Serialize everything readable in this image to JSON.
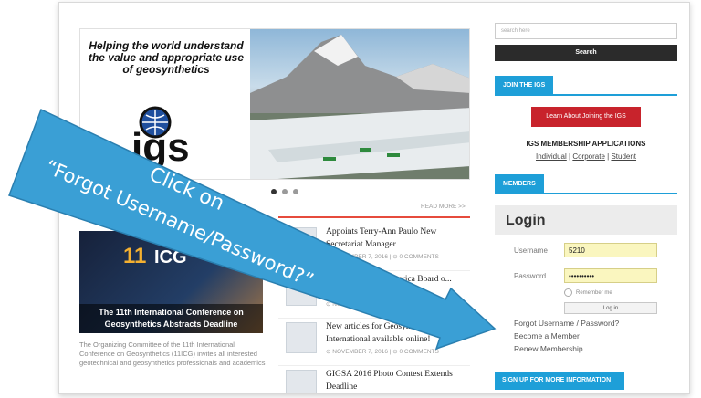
{
  "hero": {
    "tagline": "Helping the world understand the value and appropriate use of geosynthetics",
    "logo_text": "igs"
  },
  "carousel": {
    "dots": 3,
    "active": 1
  },
  "event": {
    "number": "11",
    "abbr": "ICG",
    "caption": "The 11th International Conference on Geosynthetics Abstracts Deadline",
    "excerpt": "The Organizing Committee of the 11th International Conference on Geosynthetics (11ICG) invites all interested geotechnical and geosynthetics professionals and academics"
  },
  "news": {
    "read_more": "READ MORE >>",
    "items": [
      {
        "title": "Appoints Terry-Ann Paulo New Secretariat Manager",
        "meta": "⊙ NOVEMBER 7, 2016  |  ⊙ 0 COMMENTS"
      },
      {
        "title": "Call for ... South America Board o...",
        "meta": "⊙ NOVEMBER 7, 2016  |  ⊙ 0 C..."
      },
      {
        "title": "New articles for Geosynthetics International available online!",
        "meta": "⊙ NOVEMBER 7, 2016  |  ⊙ 0 COMMENTS"
      },
      {
        "title": "GIGSA 2016 Photo Contest Extends Deadline",
        "meta": ""
      }
    ]
  },
  "sidebar": {
    "search_placeholder": "search here",
    "search_button": "Search",
    "join_head": "JOIN THE IGS",
    "learn_button": "Learn About Joining the IGS",
    "membership_title": "IGS MEMBERSHIP APPLICATIONS",
    "membership_links": [
      "Individual",
      "Corporate",
      "Student"
    ],
    "members_head": "MEMBERS",
    "login_title": "Login",
    "username_label": "Username",
    "username_value": "5210",
    "password_label": "Password",
    "password_value": "••••••••••",
    "remember_label": "Remember me",
    "login_button": "Log in",
    "forgot_link": "Forgot Username / Password?",
    "become_link": "Become a Member",
    "renew_link": "Renew Membership",
    "signup_button": "SIGN UP FOR MORE INFORMATION"
  },
  "callout": {
    "line1": "Click on",
    "line2": "“Forgot Username/Password?”",
    "color": "#3a9fd5"
  }
}
